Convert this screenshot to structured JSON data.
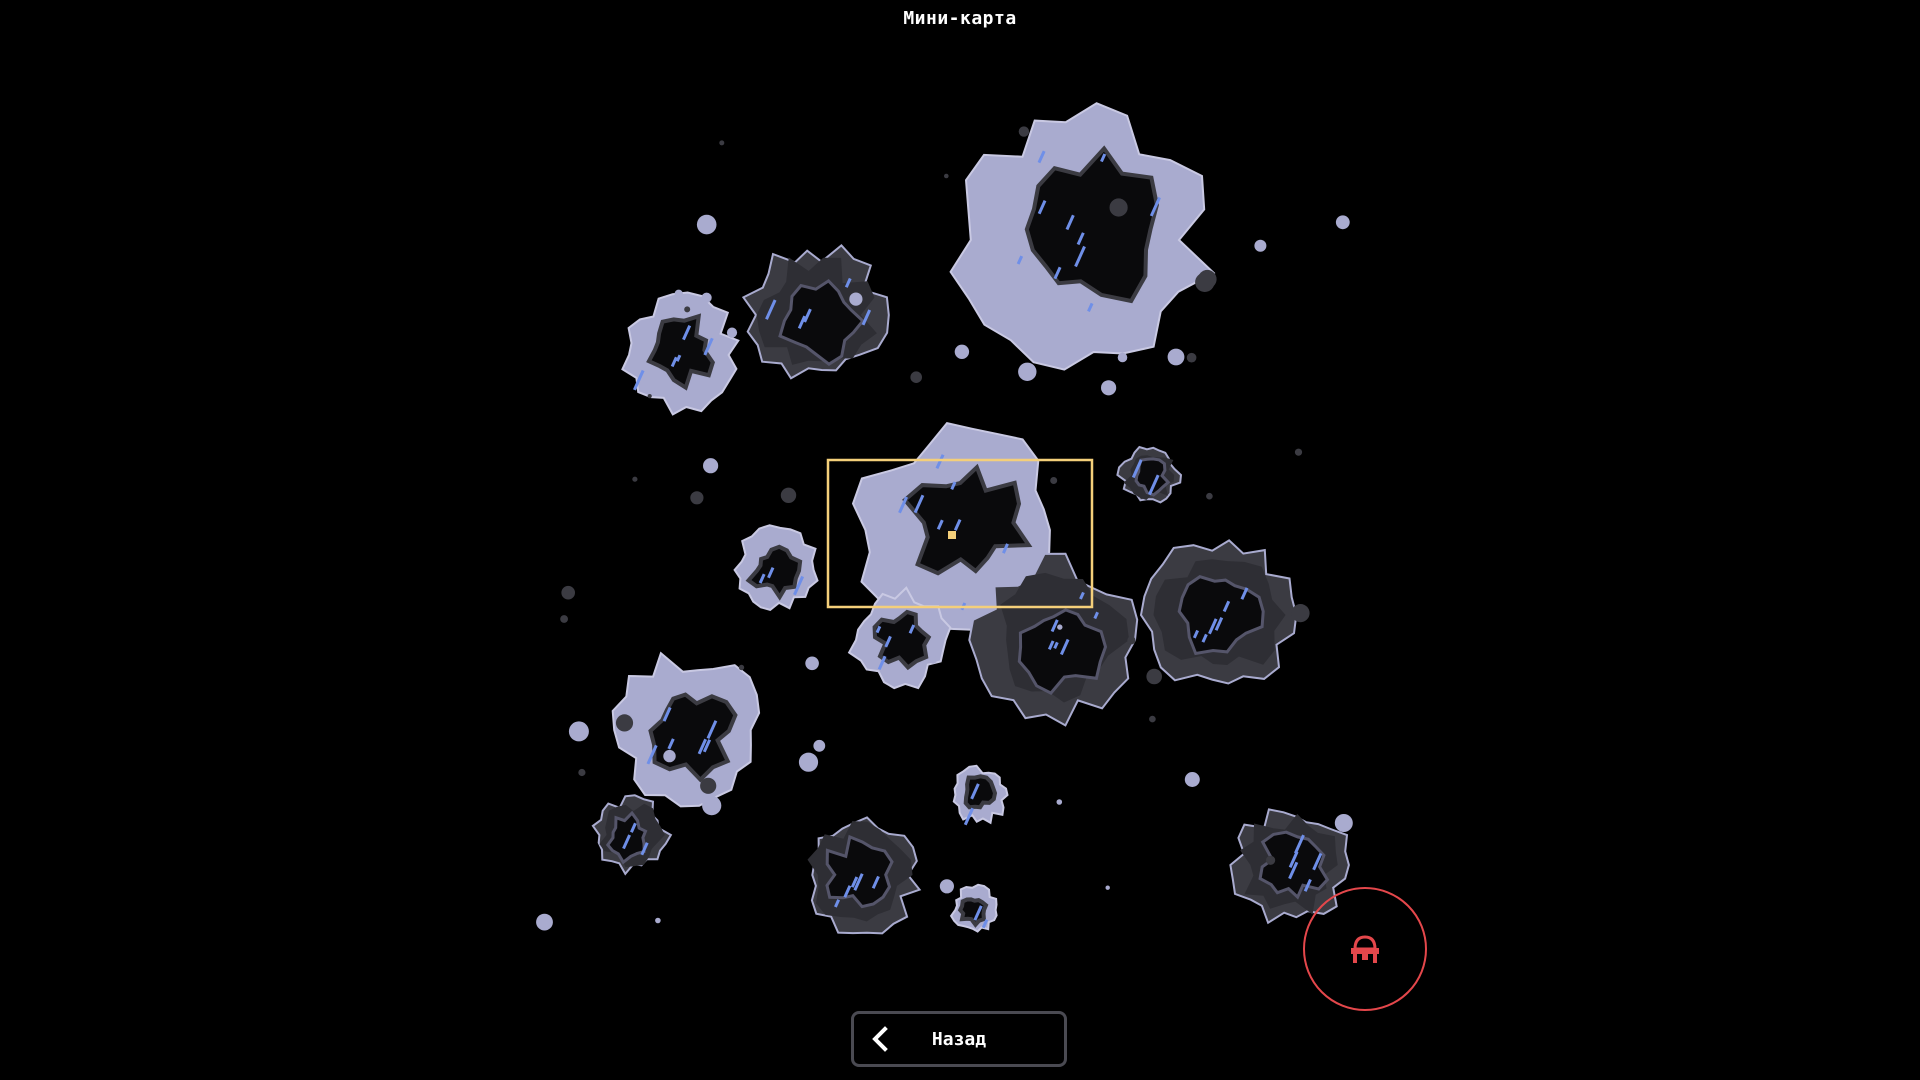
{
  "window": {
    "title": "Мини-карта"
  },
  "controls": {
    "back_label": "Назад"
  },
  "icons": {
    "back": "chevron-left-icon",
    "unit": "mech-unit-icon"
  },
  "colors": {
    "background": "#000000",
    "rock_light": "#a9abcf",
    "rock_dark": "#3b3b42",
    "rock_edge": "#c9c9e3",
    "crystal": "#6f8fe8",
    "viewport_frame": "#f4cf7a",
    "player_marker": "#f4cf7a",
    "unit_accent": "#e4474b",
    "button_border": "#4a4a52"
  }
}
